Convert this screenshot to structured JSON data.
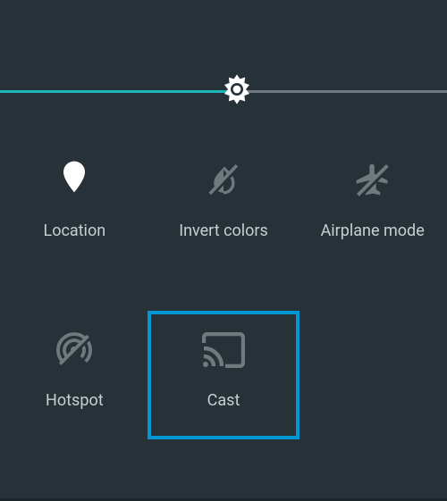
{
  "colors": {
    "background": "#263238",
    "accent_teal": "#1EB7B7",
    "slider_inactive": "#6E7B80",
    "icon_inactive": "#70797D",
    "icon_active": "#FFFFFF",
    "text": "#C8CED1",
    "selection_border": "#0397D6"
  },
  "brightness": {
    "percent": 53
  },
  "tiles": {
    "location": {
      "label": "Location",
      "active": true,
      "selected": false
    },
    "invert_colors": {
      "label": "Invert colors",
      "active": false,
      "selected": false
    },
    "airplane_mode": {
      "label": "Airplane mode",
      "active": false,
      "selected": false
    },
    "hotspot": {
      "label": "Hotspot",
      "active": false,
      "selected": false
    },
    "cast": {
      "label": "Cast",
      "active": false,
      "selected": true
    }
  }
}
